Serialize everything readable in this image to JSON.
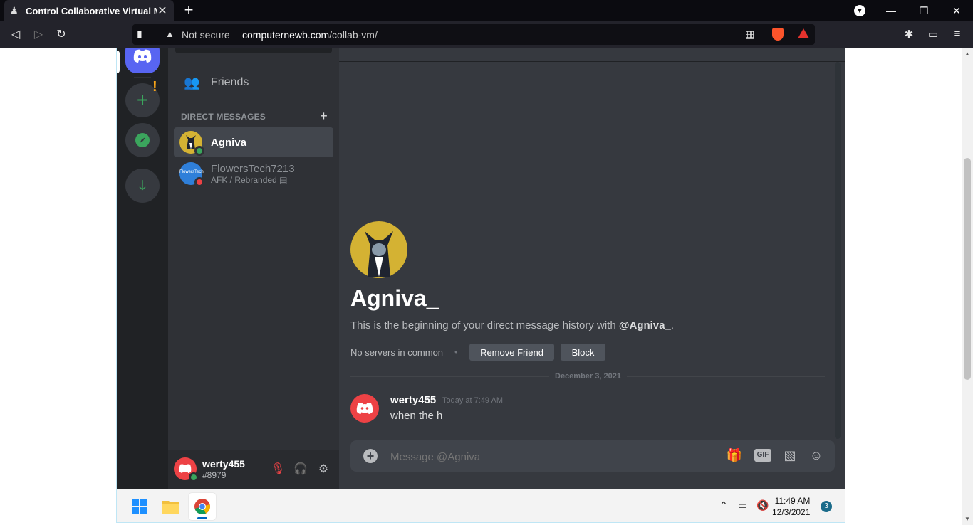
{
  "browser": {
    "tab_title": "Control Collaborative Virtual Mac",
    "not_secure": "Not secure",
    "url_domain": "computernewb.com",
    "url_path": "/collab-vm/"
  },
  "discord": {
    "friends_label": "Friends",
    "dm_header": "DIRECT MESSAGES",
    "dms": [
      {
        "name": "Agniva_",
        "status": "online"
      },
      {
        "name": "FlowersTech7213",
        "subtitle": "AFK / Rebranded",
        "avatar_text": "FlowersTech",
        "status": "dnd"
      }
    ],
    "profile": {
      "name": "Agniva_",
      "intro_prefix": "This is the beginning of your direct message history with ",
      "intro_handle": "@Agniva_",
      "intro_suffix": ".",
      "no_servers": "No servers in common",
      "remove_friend": "Remove Friend",
      "block": "Block"
    },
    "date_divider": "December 3, 2021",
    "message": {
      "author": "werty455",
      "time": "Today at 7:49 AM",
      "text": "when the h"
    },
    "composer_placeholder": "Message @Agniva_",
    "gif_label": "GIF",
    "user": {
      "name": "werty455",
      "tag": "#8979"
    }
  },
  "taskbar": {
    "time": "11:49 AM",
    "date": "12/3/2021",
    "notifications": "3"
  },
  "colors": {
    "blurple": "#5865f2",
    "online": "#3ba55d",
    "dnd": "#ed4245",
    "chat_bg": "#36393f"
  }
}
